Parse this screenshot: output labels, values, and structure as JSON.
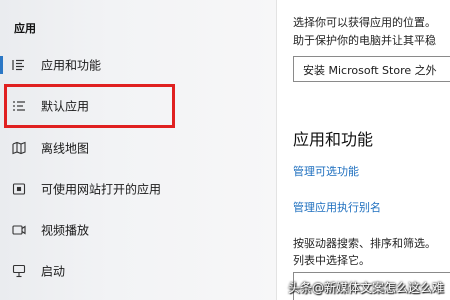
{
  "sidebar": {
    "heading": "应用",
    "items": [
      {
        "label": "应用和功能",
        "icon": "apps-list-icon"
      },
      {
        "label": "默认应用",
        "icon": "default-apps-icon"
      },
      {
        "label": "离线地图",
        "icon": "offline-map-icon"
      },
      {
        "label": "可使用网站打开的应用",
        "icon": "website-apps-icon"
      },
      {
        "label": "视频播放",
        "icon": "video-playback-icon"
      },
      {
        "label": "启动",
        "icon": "startup-icon"
      }
    ]
  },
  "main": {
    "desc_line1": "选择你可以获得应用的位置。",
    "desc_line2": "助于保护你的电脑并让其平稳",
    "dropdown_value": "安装 Microsoft Store 之外",
    "section_title": "应用和功能",
    "link_optional": "管理可选功能",
    "link_alias": "管理应用执行别名",
    "filter_line1": "按驱动器搜索、排序和筛选。",
    "filter_line2": "列表中选择它。"
  },
  "watermark": "头条@新媒体文案怎么这么难",
  "colors": {
    "accent": "#2b77c5",
    "highlight": "#e02020",
    "link": "#1e6fbf"
  }
}
